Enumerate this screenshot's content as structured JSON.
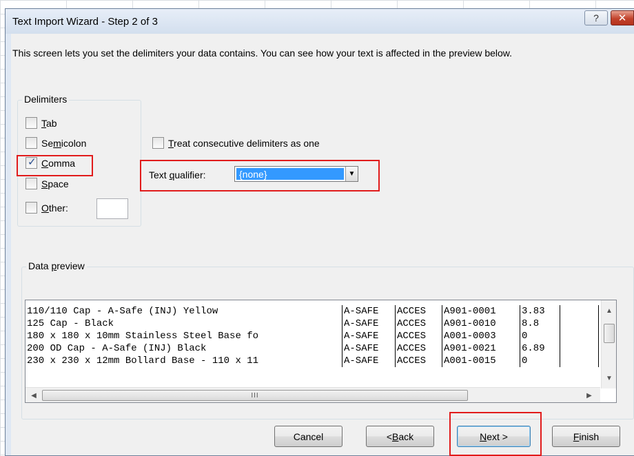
{
  "window": {
    "title": "Text Import Wizard - Step 2 of 3",
    "help_glyph": "?",
    "close_glyph": "✕"
  },
  "description": "This screen lets you set the delimiters your data contains.  You can see how your text is affected in the preview below.",
  "delimiters": {
    "group_label": "Delimiters",
    "tab": {
      "pre": "",
      "key": "T",
      "post": "ab",
      "checked": false
    },
    "semicolon": {
      "pre": "Se",
      "key": "m",
      "post": "icolon",
      "checked": false
    },
    "comma": {
      "pre": "",
      "key": "C",
      "post": "omma",
      "checked": true
    },
    "space": {
      "pre": "",
      "key": "S",
      "post": "pace",
      "checked": false
    },
    "other": {
      "pre": "",
      "key": "O",
      "post": "ther:",
      "checked": false,
      "value": ""
    }
  },
  "consecutive": {
    "pre": "",
    "key": "T",
    "post": "reat consecutive delimiters as one",
    "checked": false
  },
  "qualifier": {
    "pre": "Text ",
    "key": "q",
    "post": "ualifier:",
    "value": "{none}"
  },
  "preview": {
    "group_label_pre": "Data ",
    "group_label_key": "p",
    "group_label_post": "review",
    "rows": [
      [
        "110/110 Cap - A-Safe (INJ) Yellow",
        "A-SAFE",
        "ACCES",
        "A901-0001",
        "3.83",
        ""
      ],
      [
        "125 Cap - Black",
        "A-SAFE",
        "ACCES",
        "A901-0010",
        "8.8",
        ""
      ],
      [
        "180 x 180 x 10mm Stainless Steel Base fo",
        "A-SAFE",
        "ACCES",
        "A001-0003",
        "0",
        ""
      ],
      [
        "200 OD Cap - A-Safe (INJ) Black",
        "A-SAFE",
        "ACCES",
        "A901-0021",
        "6.89",
        ""
      ],
      [
        "230 x 230 x 12mm Bollard Base - 110 x 11",
        "A-SAFE",
        "ACCES",
        "A001-0015",
        "0",
        ""
      ]
    ],
    "hscroll_grip": "III"
  },
  "buttons": {
    "cancel": "Cancel",
    "back": {
      "pre": "< ",
      "key": "B",
      "post": "ack"
    },
    "next": {
      "pre": "",
      "key": "N",
      "post": "ext >"
    },
    "finish": {
      "pre": "",
      "key": "F",
      "post": "inish"
    }
  },
  "colors": {
    "highlight_red": "#e11b1b",
    "selection_blue": "#3399ff",
    "dialog_bg": "#f0f0f0"
  }
}
